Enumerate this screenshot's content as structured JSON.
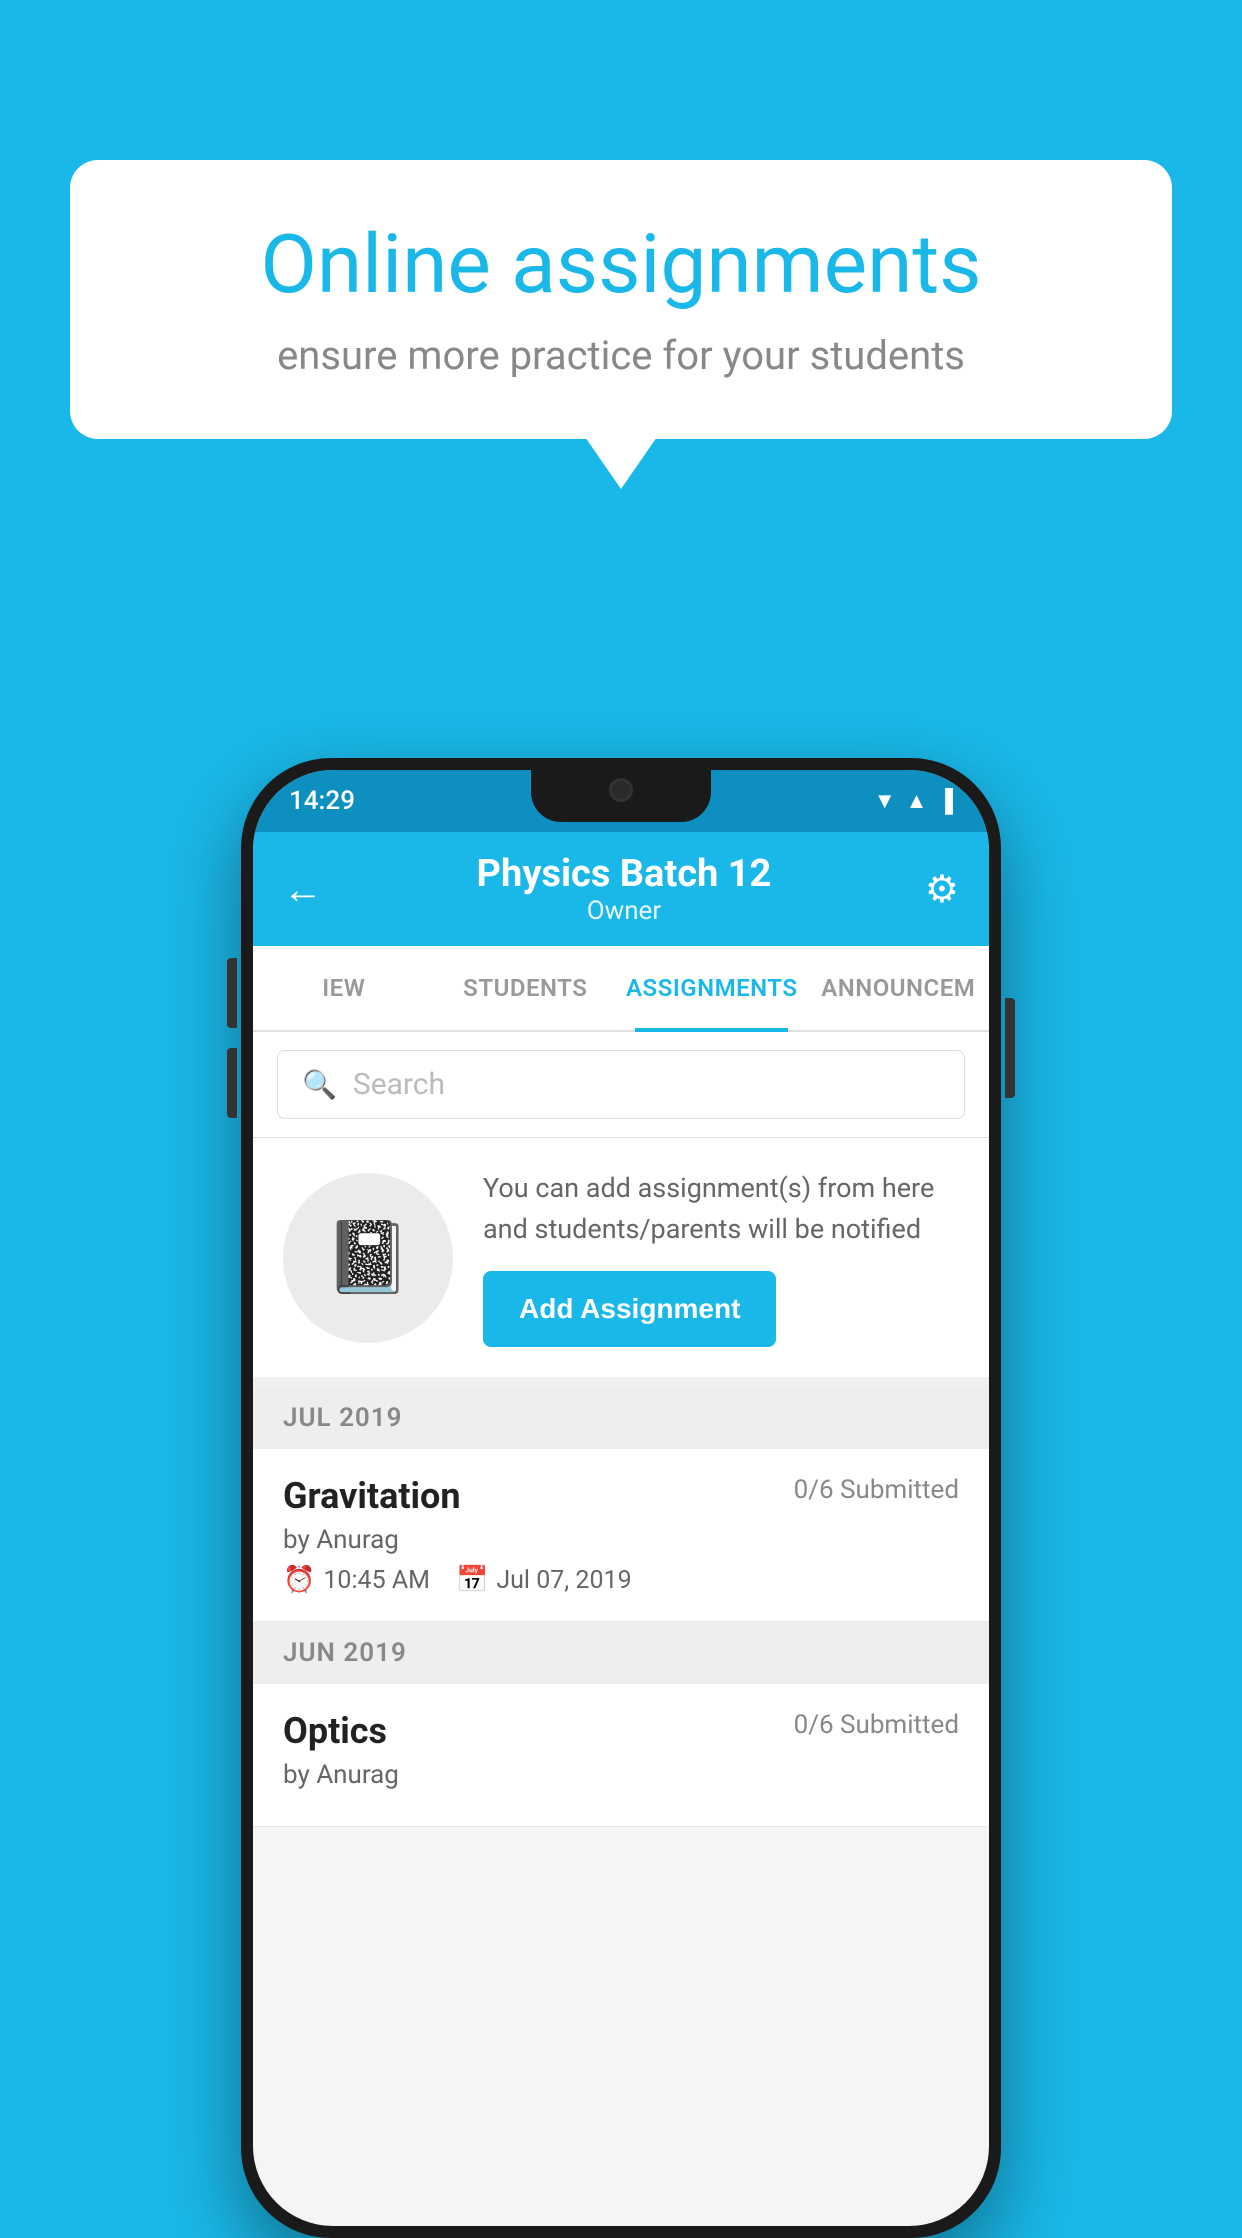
{
  "background_color": "#1ab8e8",
  "speech_bubble": {
    "title": "Online assignments",
    "subtitle": "ensure more practice for your students"
  },
  "status_bar": {
    "time": "14:29",
    "icons": [
      "wifi",
      "signal",
      "battery"
    ]
  },
  "header": {
    "title": "Physics Batch 12",
    "subtitle": "Owner",
    "back_label": "←",
    "settings_label": "⚙"
  },
  "tabs": [
    {
      "label": "IEW",
      "active": false
    },
    {
      "label": "STUDENTS",
      "active": false
    },
    {
      "label": "ASSIGNMENTS",
      "active": true
    },
    {
      "label": "ANNOUNCEM",
      "active": false
    }
  ],
  "search": {
    "placeholder": "Search"
  },
  "info_card": {
    "description": "You can add assignment(s) from here and students/parents will be notified",
    "button_label": "Add Assignment"
  },
  "sections": [
    {
      "month": "JUL 2019",
      "assignments": [
        {
          "name": "Gravitation",
          "submitted": "0/6 Submitted",
          "by": "by Anurag",
          "time": "10:45 AM",
          "date": "Jul 07, 2019"
        }
      ]
    },
    {
      "month": "JUN 2019",
      "assignments": [
        {
          "name": "Optics",
          "submitted": "0/6 Submitted",
          "by": "by Anurag",
          "time": "",
          "date": ""
        }
      ]
    }
  ]
}
